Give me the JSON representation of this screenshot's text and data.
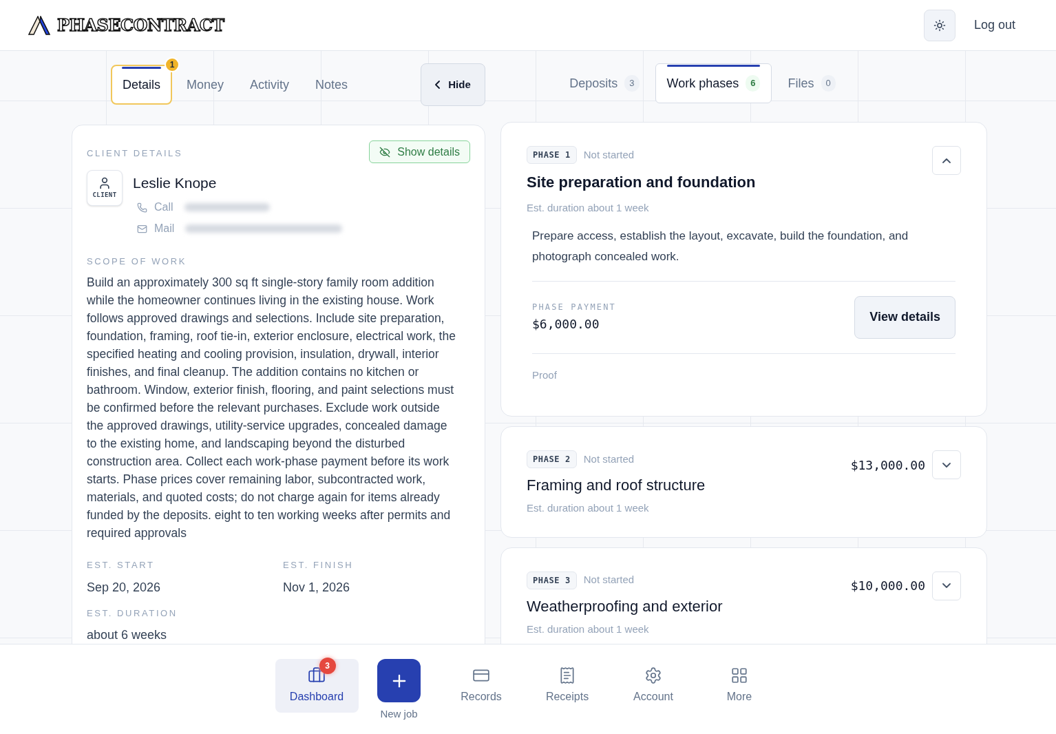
{
  "header": {
    "logo": "PHASECONTRACT",
    "logout": "Log out"
  },
  "left_tabs": [
    {
      "label": "Details",
      "selected": true,
      "badge": "1"
    },
    {
      "label": "Money",
      "selected": false
    },
    {
      "label": "Activity",
      "selected": false
    },
    {
      "label": "Notes",
      "selected": false
    }
  ],
  "hide_button": "Hide",
  "right_tabs": [
    {
      "label": "Deposits",
      "count": "3",
      "selected": false
    },
    {
      "label": "Work phases",
      "count": "6",
      "selected": true
    },
    {
      "label": "Files",
      "count": "0",
      "selected": false
    }
  ],
  "client": {
    "section_label": "CLIENT DETAILS",
    "show_details": "Show details",
    "role": "CLIENT",
    "name": "Leslie Knope",
    "contacts": [
      {
        "kind": "phone",
        "label": "Call"
      },
      {
        "kind": "mail",
        "label": "Mail"
      }
    ]
  },
  "scope": {
    "label": "SCOPE OF WORK",
    "text": "Build an approximately 300 sq ft single-story family room addition while the homeowner continues living in the existing house. Work follows approved drawings and selections. Include site preparation, foundation, framing, roof tie-in, exterior enclosure, electrical work, the specified heating and cooling provision, insulation, drywall, interior finishes, and final cleanup. The addition contains no kitchen or bathroom. Window, exterior finish, flooring, and paint selections must be confirmed before the relevant purchases. Exclude work outside the approved drawings, utility-service upgrades, concealed damage to the existing home, and landscaping beyond the disturbed construction area. Collect each work-phase payment before its work starts. Phase prices cover remaining labor, subcontracted work, materials, and quoted costs; do not charge again for items already funded by the deposits. eight to ten working weeks after permits and required approvals"
  },
  "dates": [
    {
      "label": "EST. START",
      "value": "Sep 20, 2026"
    },
    {
      "label": "EST. FINISH",
      "value": "Nov 1, 2026"
    },
    {
      "label": "EST. DURATION",
      "value": "about 6 weeks"
    }
  ],
  "phases": [
    {
      "tag": "PHASE 1",
      "status": "Not started",
      "title": "Site preparation and foundation",
      "duration": "Est. duration about 1 week",
      "expanded": true,
      "description": "Prepare access, establish the layout, excavate, build the foundation, and photograph concealed work.",
      "payment_label": "PHASE PAYMENT",
      "payment": "$6,000.00",
      "view_button": "View details",
      "proof_label": "Proof"
    },
    {
      "tag": "PHASE 2",
      "status": "Not started",
      "title": "Framing and roof structure",
      "duration": "Est. duration about 1 week",
      "expanded": false,
      "payment": "$13,000.00"
    },
    {
      "tag": "PHASE 3",
      "status": "Not started",
      "title": "Weatherproofing and exterior",
      "duration": "Est. duration about 1 week",
      "expanded": false,
      "payment": "$10,000.00"
    }
  ],
  "bottom_nav": [
    {
      "kind": "dashboard",
      "label": "Dashboard",
      "selected": true,
      "badge": "3"
    },
    {
      "kind": "new",
      "label": "New job"
    },
    {
      "kind": "records",
      "label": "Records",
      "selected": false
    },
    {
      "kind": "receipts",
      "label": "Receipts",
      "selected": false
    },
    {
      "kind": "account",
      "label": "Account",
      "selected": false
    },
    {
      "kind": "more",
      "label": "More",
      "selected": false
    }
  ]
}
